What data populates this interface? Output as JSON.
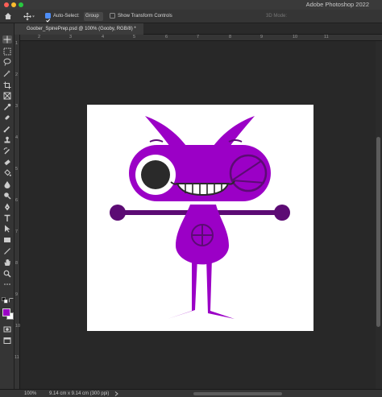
{
  "window": {
    "app_title": "Adobe Photoshop 2022"
  },
  "options_bar": {
    "auto_select_label": "Auto-Select:",
    "auto_select_checked": true,
    "auto_select_target": "Group",
    "show_transform_label": "Show Transform Controls",
    "show_transform_checked": false,
    "mode_3d_label": "3D Mode:"
  },
  "document": {
    "tab_title": "Goober_SpinePrep.psd @ 100% (Gooby, RGB/8) *"
  },
  "ruler": {
    "top_labels": [
      "2",
      "3",
      "4",
      "5",
      "6",
      "7",
      "8",
      "9",
      "10",
      "11"
    ],
    "left_labels": [
      "1",
      "2",
      "3",
      "4",
      "5",
      "6",
      "7",
      "8",
      "9",
      "10",
      "11"
    ]
  },
  "status": {
    "zoom": "100%",
    "doc_info": "9.14 cm x 9.14 cm (300 ppi)"
  },
  "colors": {
    "foreground": "#9b00c6",
    "background": "#ffffff",
    "character_primary": "#9b00c6",
    "character_dark": "#5c0b74"
  },
  "tools": [
    "move-tool-icon",
    "marquee-tool-icon",
    "lasso-tool-icon",
    "magic-wand-tool-icon",
    "crop-tool-icon",
    "frame-tool-icon",
    "eyedropper-tool-icon",
    "healing-brush-tool-icon",
    "brush-tool-icon",
    "clone-stamp-tool-icon",
    "history-brush-tool-icon",
    "eraser-tool-icon",
    "paint-bucket-tool-icon",
    "blur-tool-icon",
    "dodge-tool-icon",
    "pen-tool-icon",
    "type-tool-icon",
    "path-selection-tool-icon",
    "rectangle-tool-icon",
    "line-tool-icon",
    "hand-tool-icon",
    "zoom-tool-icon"
  ]
}
